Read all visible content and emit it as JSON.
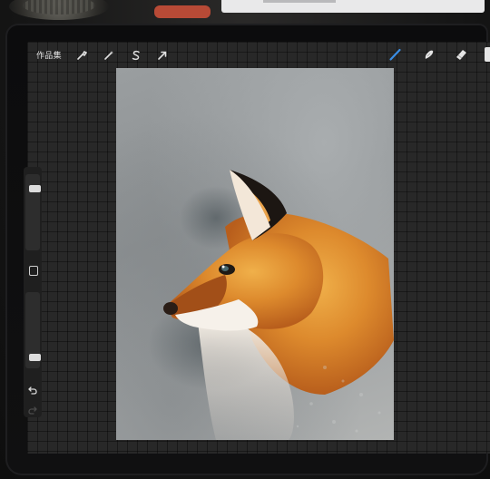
{
  "toolbar": {
    "gallery_label": "作品集",
    "tools": [
      {
        "name": "actions",
        "icon": "wrench-icon"
      },
      {
        "name": "adjustments",
        "icon": "magic-wand-icon"
      },
      {
        "name": "selection",
        "icon": "selection-s-icon"
      },
      {
        "name": "transform",
        "icon": "arrow-cursor-icon"
      }
    ],
    "drawing_tools": [
      {
        "name": "brush",
        "icon": "brush-icon",
        "active": true
      },
      {
        "name": "smudge",
        "icon": "smudge-icon"
      },
      {
        "name": "eraser",
        "icon": "eraser-icon"
      }
    ]
  },
  "sidebar": {
    "brush_size_level": 0.15,
    "opacity_level": 0.88,
    "icons": [
      "square-modify-icon",
      "undo-icon",
      "redo-icon"
    ]
  },
  "canvas": {
    "subject": "fox-painting"
  },
  "colors": {
    "accent": "#3a8ee6",
    "ui_background": "#282828",
    "fox_orange": "#d9822b"
  }
}
